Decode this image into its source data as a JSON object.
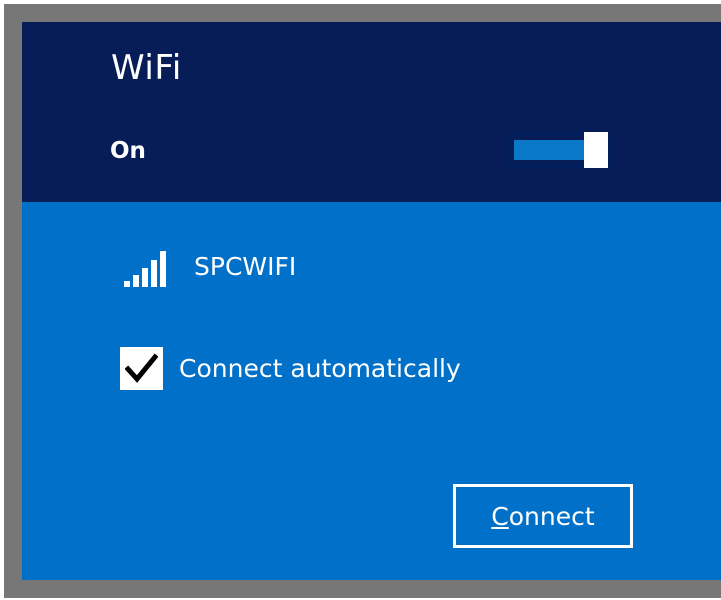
{
  "panel": {
    "title": "WiFi",
    "state_label": "On",
    "toggle": {
      "on": true
    }
  },
  "network": {
    "name": "SPCWIFI",
    "signal_icon": "wifi-signal-bars-icon",
    "signal_bars": 5,
    "signal_bars_filled": 5
  },
  "connect_automatically": {
    "label": "Connect automatically",
    "checked": true,
    "check_icon": "checkmark-icon"
  },
  "connect_button": {
    "label_first": "C",
    "label_rest": "onnect",
    "accelerator": "C"
  },
  "colors": {
    "header_bg": "#061d58",
    "panel_bg": "#0070c8",
    "frame": "#777777",
    "toggle_fill": "#0a78c8",
    "text": "#ffffff"
  }
}
